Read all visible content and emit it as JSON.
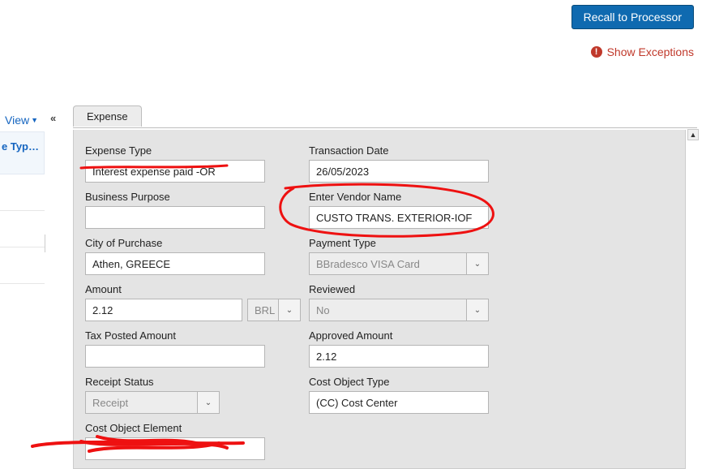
{
  "header": {
    "recall_button": "Recall to Processor",
    "exceptions": "Show Exceptions"
  },
  "rail": {
    "view_label": "View",
    "item_trunc": "e Typ…"
  },
  "tabs": {
    "expense": "Expense"
  },
  "fields": {
    "expense_type": {
      "label": "Expense Type",
      "value": "Interest expense paid -OR"
    },
    "business_purpose": {
      "label": "Business Purpose",
      "value": ""
    },
    "city_of_purchase": {
      "label": "City of Purchase",
      "value": "Athen, GREECE"
    },
    "amount": {
      "label": "Amount",
      "value": "2.12",
      "currency": "BRL"
    },
    "tax_posted_amount": {
      "label": "Tax Posted Amount",
      "value": ""
    },
    "receipt_status": {
      "label": "Receipt Status",
      "value": "Receipt"
    },
    "cost_object_element": {
      "label": "Cost Object Element",
      "value": ""
    },
    "transaction_date": {
      "label": "Transaction Date",
      "value": "26/05/2023"
    },
    "vendor_name": {
      "label": "Enter Vendor Name",
      "value": "CUSTO TRANS. EXTERIOR-IOF"
    },
    "payment_type": {
      "label": "Payment Type",
      "value": "BBradesco VISA Card"
    },
    "reviewed": {
      "label": "Reviewed",
      "value": "No"
    },
    "approved_amount": {
      "label": "Approved Amount",
      "value": "2.12"
    },
    "cost_object_type": {
      "label": "Cost Object Type",
      "value": "(CC) Cost Center"
    }
  }
}
